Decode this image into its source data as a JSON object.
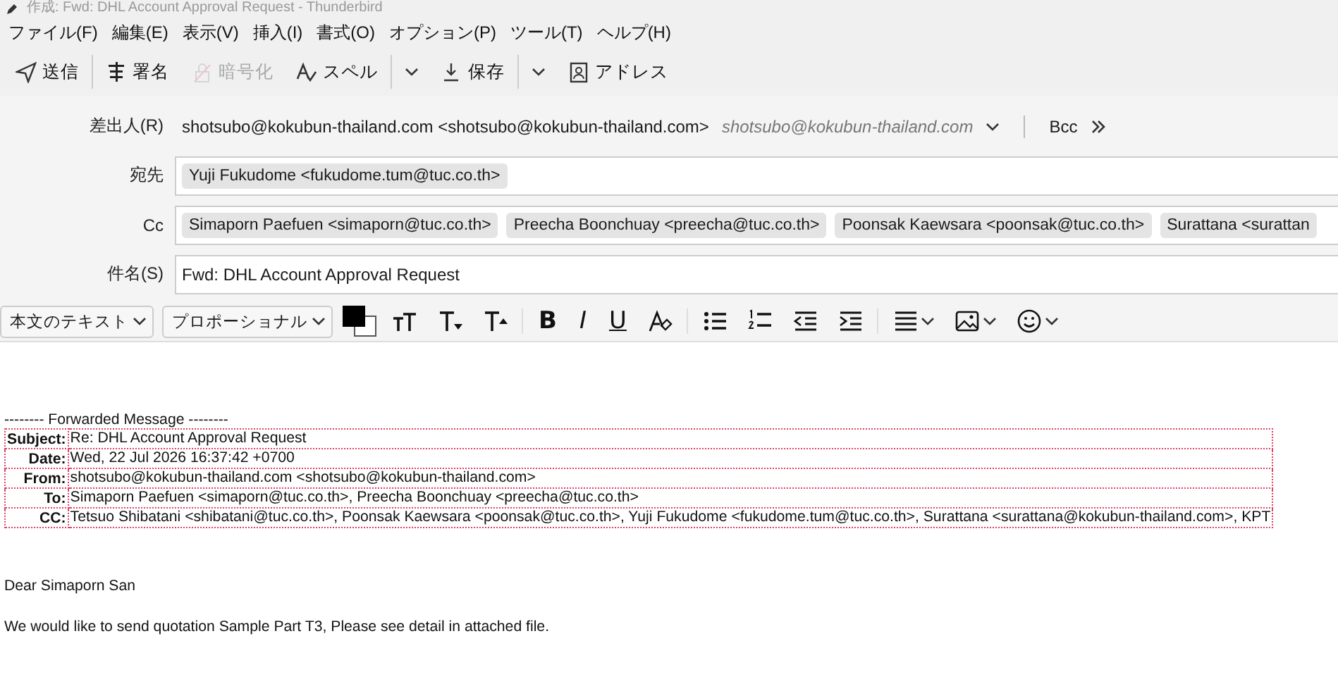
{
  "window": {
    "title": "作成: Fwd: DHL Account Approval Request - Thunderbird"
  },
  "menu": [
    "ファイル(F)",
    "編集(E)",
    "表示(V)",
    "挿入(I)",
    "書式(O)",
    "オプション(P)",
    "ツール(T)",
    "ヘルプ(H)"
  ],
  "toolbar": [
    {
      "kind": "send",
      "label": "送信"
    },
    {
      "kind": "signature",
      "label": "署名"
    },
    {
      "kind": "encrypt",
      "label": "暗号化",
      "disabled": true
    },
    {
      "kind": "spell",
      "label": "スペル"
    },
    {
      "kind": "dropdown"
    },
    {
      "kind": "save",
      "label": "保存"
    },
    {
      "kind": "dropdown"
    },
    {
      "kind": "addressbook",
      "label": "アドレス"
    }
  ],
  "header": {
    "from": {
      "label": "差出人(R)",
      "value": "shotsubo@kokubun-thailand.com <shotsubo@kokubun-thailand.com>",
      "identity": "shotsubo@kokubun-thailand.com",
      "bcc": "Bcc"
    },
    "to": {
      "label": "宛先",
      "recipients": [
        "Yuji Fukudome <fukudome.tum@tuc.co.th>"
      ]
    },
    "cc": {
      "label": "Cc",
      "recipients": [
        "Simaporn Paefuen <simaporn@tuc.co.th>",
        "Preecha Boonchuay <preecha@tuc.co.th>",
        "Poonsak Kaewsara <poonsak@tuc.co.th>",
        "Surattana <surattan"
      ]
    },
    "subject": {
      "label": "件名(S)",
      "value": "Fwd: DHL Account Approval Request"
    }
  },
  "format_bar": {
    "paragraph": "本文のテキスト",
    "font": "プロポーショナル",
    "tools": [
      {
        "kind": "smaller"
      },
      {
        "kind": "size-down"
      },
      {
        "kind": "size-up"
      },
      {
        "kind": "sep"
      },
      {
        "kind": "bold",
        "glyph": "B"
      },
      {
        "kind": "italic",
        "glyph": "I"
      },
      {
        "kind": "underline",
        "glyph": "U"
      },
      {
        "kind": "clear"
      },
      {
        "kind": "sep"
      },
      {
        "kind": "bullets"
      },
      {
        "kind": "numbers"
      },
      {
        "kind": "outdent"
      },
      {
        "kind": "indent"
      },
      {
        "kind": "sep"
      },
      {
        "kind": "align"
      },
      {
        "kind": "image"
      },
      {
        "kind": "emoji"
      }
    ]
  },
  "body": {
    "forward_line": "-------- Forwarded Message --------",
    "fields": [
      {
        "label": "Subject:",
        "value": "Re: DHL Account Approval Request"
      },
      {
        "label": "Date:",
        "value": "Wed, 22 Jul 2026 16:37:42 +0700"
      },
      {
        "label": "From:",
        "value": "shotsubo@kokubun-thailand.com <shotsubo@kokubun-thailand.com>"
      },
      {
        "label": "To:",
        "value": "Simaporn Paefuen <simaporn@tuc.co.th>, Preecha Boonchuay <preecha@tuc.co.th>"
      },
      {
        "label": "CC:",
        "value": "Tetsuo Shibatani <shibatani@tuc.co.th>, Poonsak Kaewsara <poonsak@tuc.co.th>, Yuji Fukudome <fukudome.tum@tuc.co.th>, Surattana <surattana@kokubun-thailand.com>, KPT"
      }
    ],
    "paragraphs": [
      "Dear Simaporn San",
      "We would like to send quotation Sample Part T3, Please see detail in attached file."
    ]
  }
}
